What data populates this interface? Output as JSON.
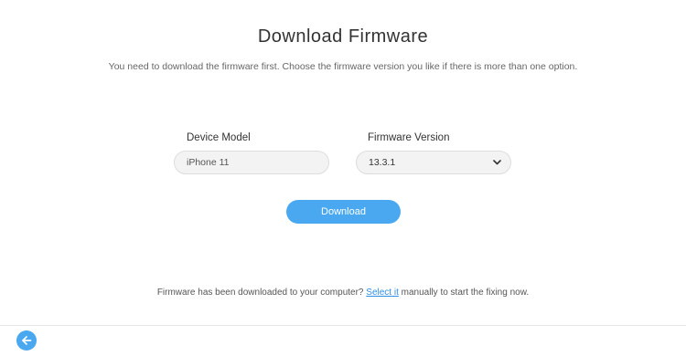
{
  "header": {
    "title": "Download Firmware",
    "subtitle": "You need to download the firmware first. Choose the firmware version you like if there is more than one option."
  },
  "form": {
    "device_model_label": "Device Model",
    "device_model_value": "iPhone 11",
    "firmware_version_label": "Firmware Version",
    "firmware_version_value": "13.3.1"
  },
  "actions": {
    "download_label": "Download"
  },
  "footer": {
    "note_prefix": "Firmware has been downloaded to your computer?",
    "link_text": "Select it",
    "note_suffix": "manually to start the fixing now."
  },
  "icons": {
    "dropdown": "chevron-down-icon",
    "back": "arrow-left-icon"
  },
  "colors": {
    "accent": "#4aa8f0",
    "link": "#2f8fe6"
  }
}
